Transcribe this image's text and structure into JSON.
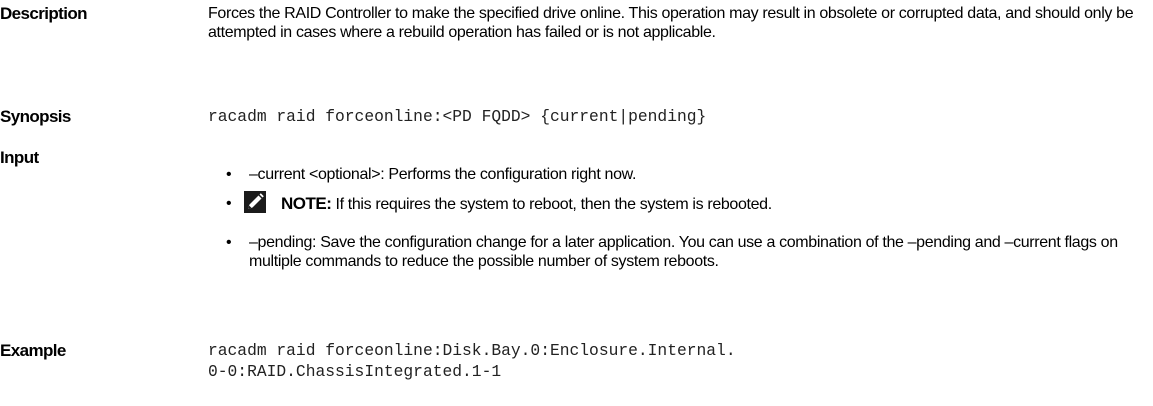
{
  "sections": {
    "description": {
      "label": "Description",
      "text": "Forces the RAID Controller to make the specified drive online. This operation may result in obsolete or corrupted data, and should only be attempted in cases where a rebuild operation has failed or is not applicable."
    },
    "synopsis": {
      "label": "Synopsis",
      "code": "racadm raid forceonline:<PD FQDD> {current|pending}"
    },
    "input": {
      "label": "Input",
      "items": [
        {
          "text": "–current <optional>: Performs the configuration right now."
        },
        {
          "note_label": "NOTE:",
          "note_text": " If this requires the system to reboot, then the system is rebooted."
        },
        {
          "text": "–pending: Save the configuration change for a later application. You can use a combination of the –pending and –current flags on multiple commands to reduce the possible number of system reboots."
        }
      ]
    },
    "example": {
      "label": "Example",
      "code_line1": "racadm raid forceonline:Disk.Bay.0:Enclosure.Internal.",
      "code_line2": "0-0:RAID.ChassisIntegrated.1-1"
    }
  },
  "icons": {
    "note": "note-pencil-icon"
  },
  "colors": {
    "text": "#000000",
    "code": "#222222",
    "note_icon_bg": "#1b1b1b"
  }
}
